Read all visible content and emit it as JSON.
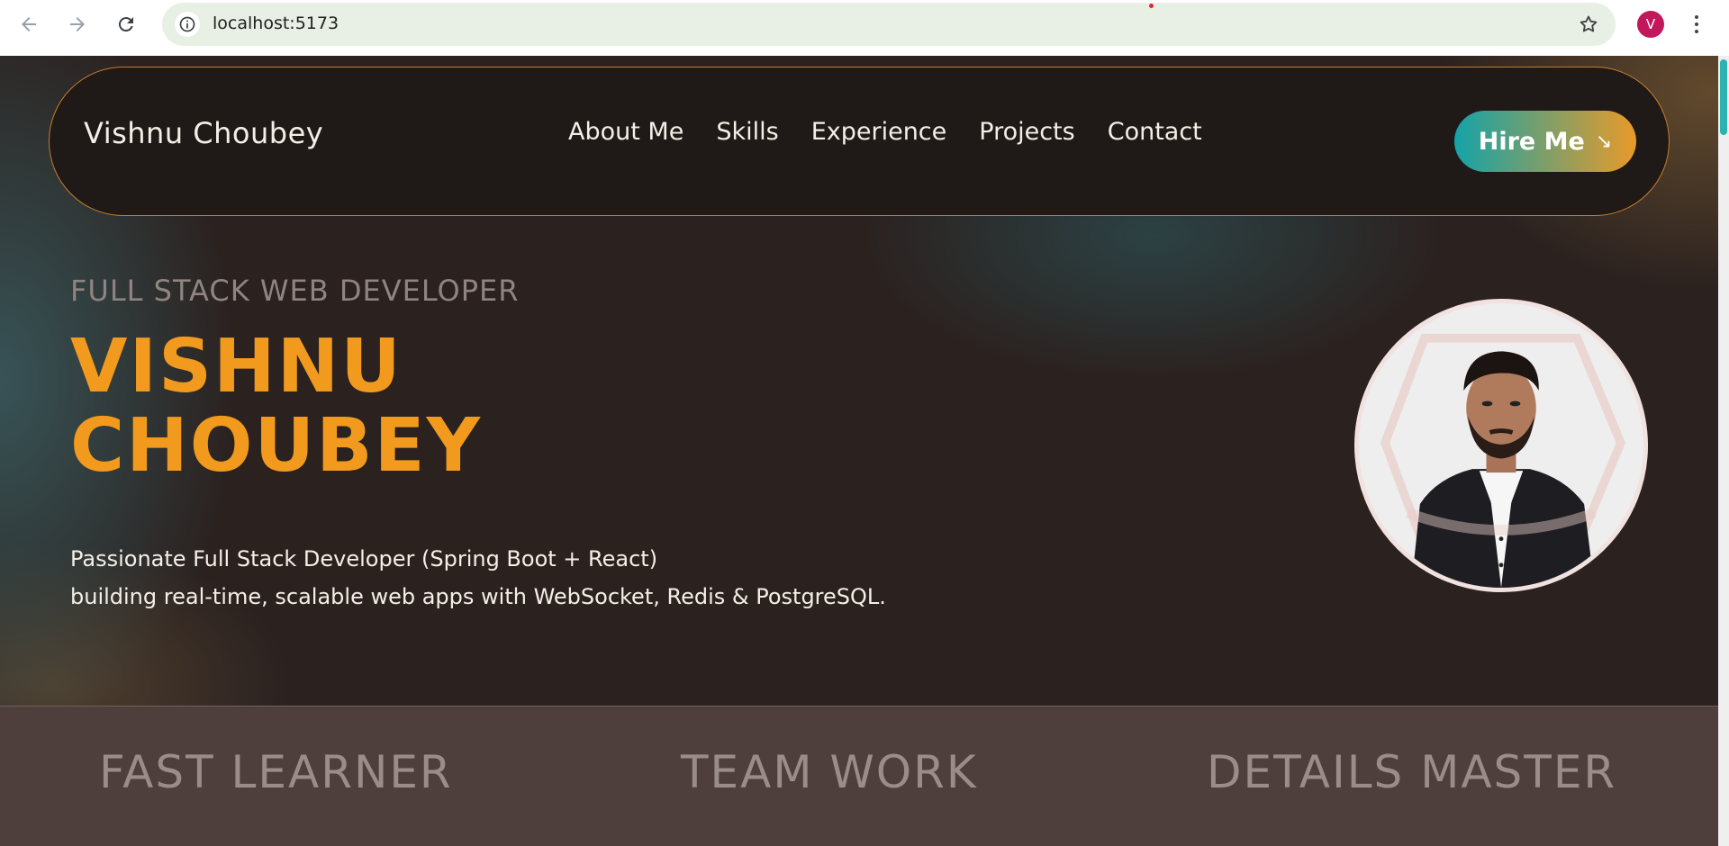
{
  "browser": {
    "url": "localhost:5173",
    "profile_initial": "V",
    "profile_color": "#c2185b"
  },
  "navbar": {
    "brand": "Vishnu Choubey",
    "links": [
      "About Me",
      "Skills",
      "Experience",
      "Projects",
      "Contact"
    ],
    "hire_label": "Hire Me",
    "hire_arrow": "↘"
  },
  "hero": {
    "subtitle": "FULL STACK WEB DEVELOPER",
    "name_line1": "VISHNU",
    "name_line2": "CHOUBEY",
    "desc_line1": "Passionate Full Stack Developer (Spring Boot + React)",
    "desc_line2": "building real-time, scalable web apps with WebSocket, Redis & PostgreSQL."
  },
  "highlights": [
    "FAST LEARNER",
    "TEAM WORK",
    "DETAILS MASTER"
  ],
  "colors": {
    "accent_orange": "#f29a1e",
    "accent_teal": "#14a3a8",
    "background": "#2b2220",
    "nav_border": "#c77d2a"
  },
  "icons": [
    "back-arrow-icon",
    "forward-arrow-icon",
    "reload-icon",
    "info-icon",
    "star-icon",
    "menu-kebab-icon",
    "arrow-down-right-icon"
  ]
}
